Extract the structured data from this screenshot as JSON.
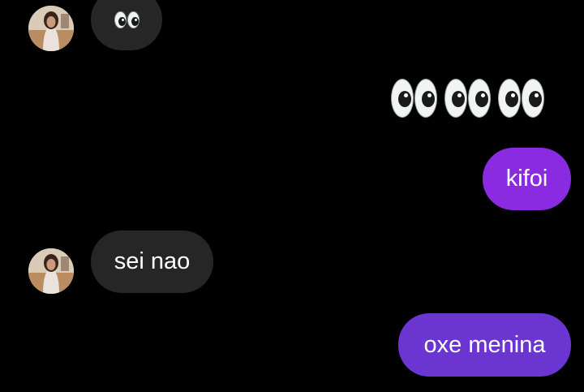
{
  "thread": {
    "messages": [
      {
        "direction": "incoming",
        "type": "emoji",
        "emoji_name": "eyes-emoji",
        "count": 1,
        "text": "👀"
      },
      {
        "direction": "outgoing",
        "type": "emoji",
        "emoji_name": "eyes-emoji",
        "count": 3,
        "text": "👀👀👀"
      },
      {
        "direction": "outgoing",
        "type": "text",
        "text": "kifoi"
      },
      {
        "direction": "incoming",
        "type": "text",
        "text": "sei nao"
      },
      {
        "direction": "outgoing",
        "type": "text",
        "text": "oxe menina"
      }
    ]
  },
  "colors": {
    "background": "#000000",
    "incoming_bubble": "#262626",
    "outgoing_bubble_top": "#8a2be2",
    "outgoing_bubble_bottom": "#6a35d0",
    "text": "#ffffff"
  }
}
